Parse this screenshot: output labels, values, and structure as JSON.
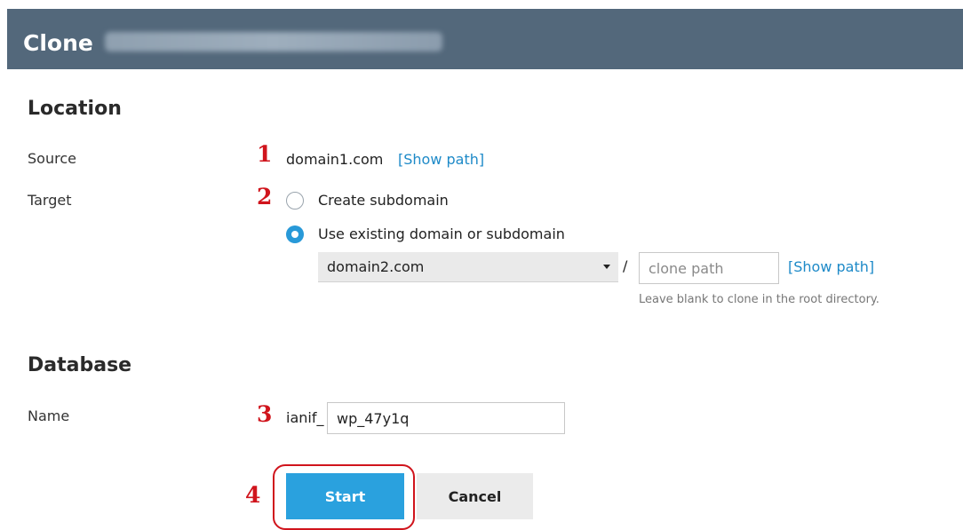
{
  "header": {
    "title": "Clone"
  },
  "location": {
    "heading": "Location",
    "source": {
      "label": "Source",
      "step": "1",
      "value": "domain1.com",
      "show_path": "[Show path]"
    },
    "target": {
      "label": "Target",
      "step": "2",
      "option_create": "Create subdomain",
      "option_existing": "Use existing domain or subdomain",
      "selected_option": "existing",
      "domain_select": "domain2.com",
      "separator": "/",
      "path_value": "",
      "path_placeholder": "clone path",
      "show_path": "[Show path]",
      "hint": "Leave blank to clone in the root directory."
    }
  },
  "database": {
    "heading": "Database",
    "name": {
      "label": "Name",
      "step": "3",
      "prefix": "ianif_",
      "value": "wp_47y1q"
    }
  },
  "actions": {
    "step": "4",
    "start": "Start",
    "cancel": "Cancel"
  },
  "colors": {
    "header_bg": "#53687b",
    "accent": "#2aa1de",
    "link": "#1e8ac8",
    "annotation": "#d0141c"
  }
}
